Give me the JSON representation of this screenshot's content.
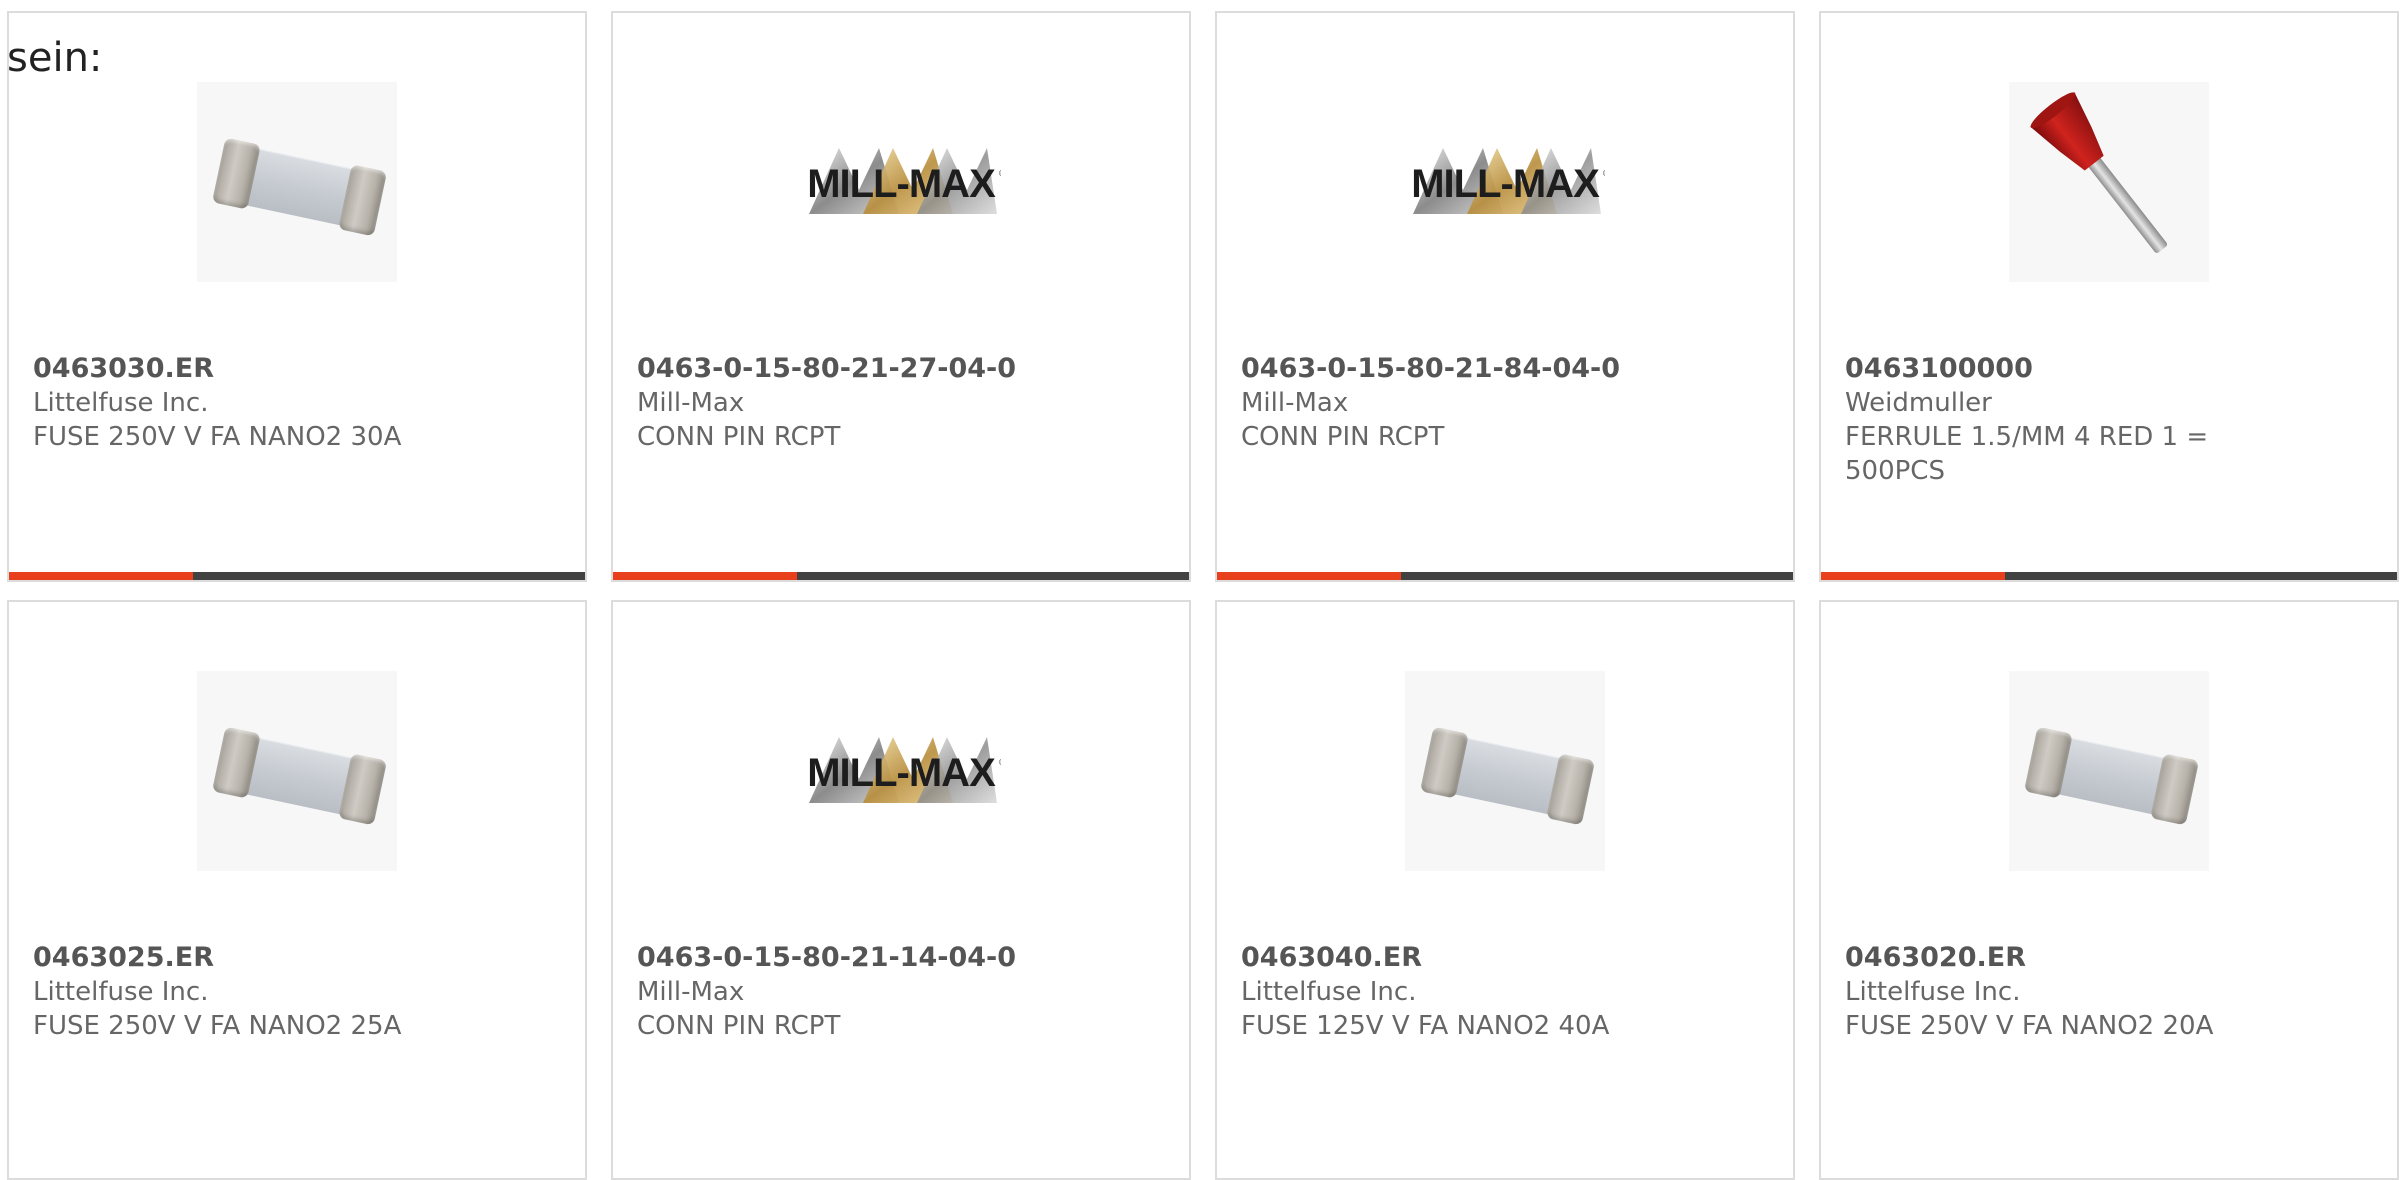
{
  "intro_text": "sein:",
  "colors": {
    "accent": "#e8401c",
    "bar_track": "#424242",
    "border": "#dcdcdc",
    "text": "#666666"
  },
  "products": [
    {
      "part_number": "0463030.ER",
      "manufacturer": "Littelfuse Inc.",
      "description": "FUSE 250V V FA NANO2 30A",
      "image": "fuse-image",
      "progress": 0.32
    },
    {
      "part_number": "0463-0-15-80-21-27-04-0",
      "manufacturer": "Mill-Max",
      "description": "CONN PIN RCPT",
      "image": "mill-max-logo",
      "logo_text": "MILL-MAX",
      "progress": 0.32
    },
    {
      "part_number": "0463-0-15-80-21-84-04-0",
      "manufacturer": "Mill-Max",
      "description": "CONN PIN RCPT",
      "image": "mill-max-logo",
      "logo_text": "MILL-MAX",
      "progress": 0.32
    },
    {
      "part_number": "0463100000",
      "manufacturer": "Weidmuller",
      "description": "FERRULE 1.5/MM 4 RED 1 = 500PCS",
      "image": "ferrule-image",
      "progress": 0.32
    },
    {
      "part_number": "0463025.ER",
      "manufacturer": "Littelfuse Inc.",
      "description": "FUSE 250V V FA NANO2 25A",
      "image": "fuse-image"
    },
    {
      "part_number": "0463-0-15-80-21-14-04-0",
      "manufacturer": "Mill-Max",
      "description": "CONN PIN RCPT",
      "image": "mill-max-logo",
      "logo_text": "MILL-MAX"
    },
    {
      "part_number": "0463040.ER",
      "manufacturer": "Littelfuse Inc.",
      "description": "FUSE 125V V FA NANO2 40A",
      "image": "fuse-image"
    },
    {
      "part_number": "0463020.ER",
      "manufacturer": "Littelfuse Inc.",
      "description": "FUSE 250V V FA NANO2 20A",
      "image": "fuse-image"
    }
  ]
}
